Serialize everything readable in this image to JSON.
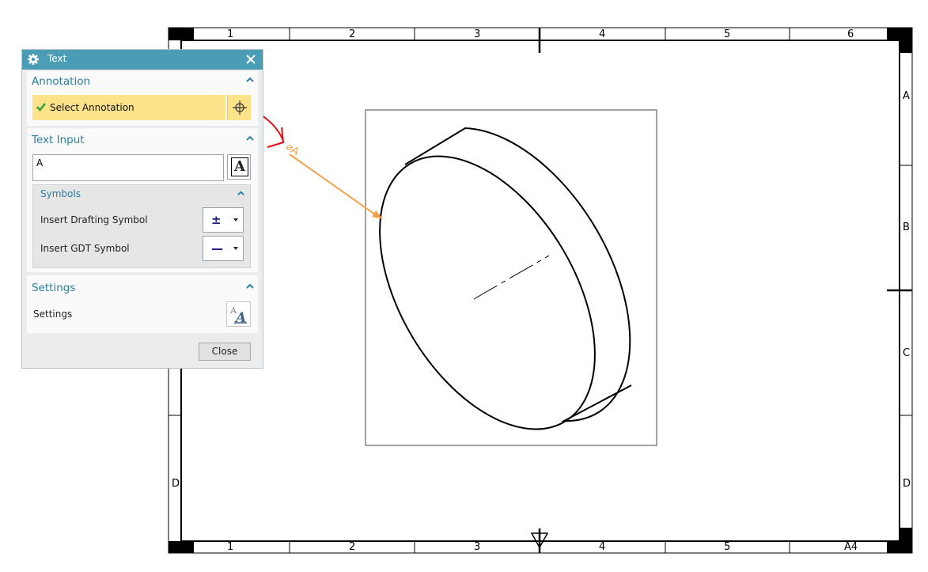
{
  "drawing": {
    "zones_top": [
      "1",
      "2",
      "3",
      "4",
      "5",
      "6"
    ],
    "zones_bottom": [
      "1",
      "2",
      "3",
      "4",
      "5",
      "A4"
    ],
    "zones_right": [
      "A",
      "B",
      "C",
      "D"
    ],
    "zones_left": [
      "D"
    ],
    "leader_label": "⌀A"
  },
  "dialog": {
    "title": "Text",
    "sections": {
      "annotation": {
        "label": "Annotation",
        "select_label": "Select Annotation"
      },
      "text_input": {
        "label": "Text Input",
        "value": "A"
      },
      "symbols": {
        "label": "Symbols",
        "drafting_label": "Insert Drafting Symbol",
        "drafting_glyph": "±",
        "gdt_label": "Insert GDT Symbol",
        "gdt_glyph": "—"
      },
      "settings": {
        "label": "Settings",
        "row_label": "Settings"
      }
    },
    "close_label": "Close"
  },
  "colors": {
    "titlebar": "#4a9db5",
    "section_heading": "#2b7fa0",
    "selection_highlight": "#fce38a",
    "leader": "#f2a24a",
    "markup": "#e01010"
  }
}
